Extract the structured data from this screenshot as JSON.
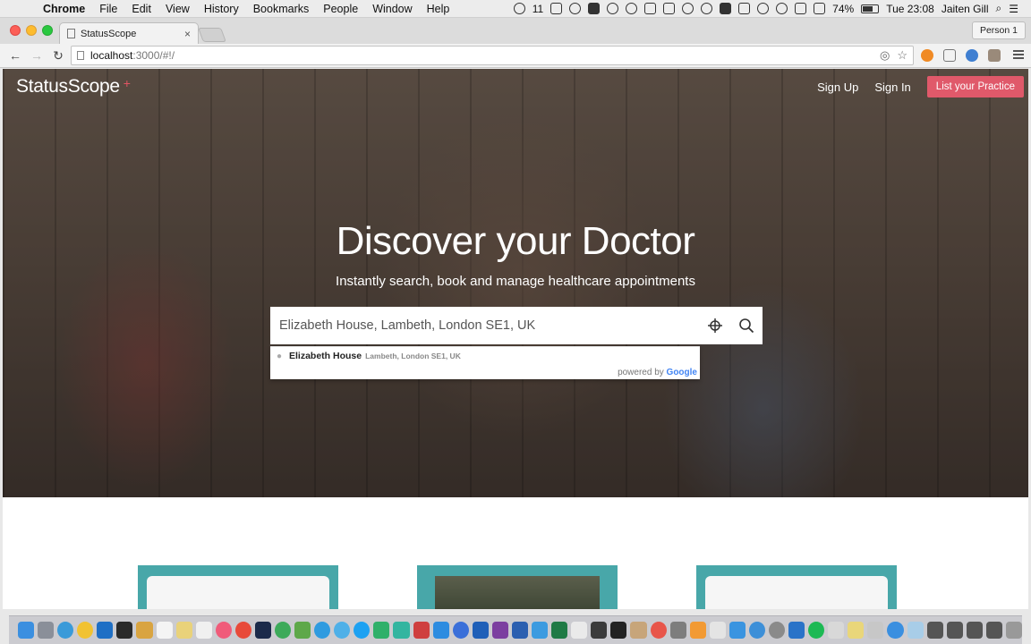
{
  "menubar": {
    "app_name": "Chrome",
    "items": [
      "File",
      "Edit",
      "View",
      "History",
      "Bookmarks",
      "People",
      "Window",
      "Help"
    ],
    "notification_count": "11",
    "battery": "74%",
    "clock": "Tue 23:08",
    "user": "Jaiten Gill"
  },
  "browser": {
    "tab_title": "StatusScope",
    "profile": "Person 1",
    "url_host": "localhost",
    "url_path": ":3000/#!/"
  },
  "page": {
    "brand": "StatusScope",
    "brand_mark": "+",
    "nav": {
      "sign_up": "Sign Up",
      "sign_in": "Sign In",
      "list_practice": "List your Practice"
    },
    "hero": {
      "title": "Discover your Doctor",
      "subtitle": "Instantly search, book and manage healthcare appointments"
    },
    "search": {
      "value": "Elizabeth House, Lambeth, London SE1, UK"
    },
    "suggestion": {
      "main": "Elizabeth House",
      "secondary": "Lambeth, London SE1, UK",
      "powered_by": "powered by",
      "google": "Google"
    }
  },
  "colors": {
    "accent": "#e0596a",
    "card_teal": "#48a7a9"
  }
}
